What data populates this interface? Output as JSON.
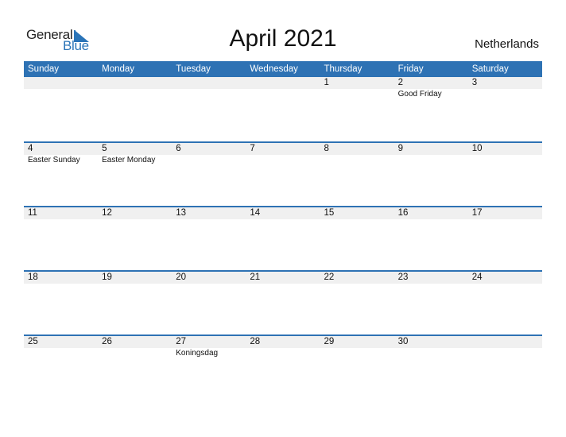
{
  "logo": {
    "general": "General",
    "blue": "Blue"
  },
  "title": "April 2021",
  "country": "Netherlands",
  "accent_color": "#2e72b4",
  "weekdays": [
    "Sunday",
    "Monday",
    "Tuesday",
    "Wednesday",
    "Thursday",
    "Friday",
    "Saturday"
  ],
  "weeks": [
    [
      {
        "day": "",
        "holiday": ""
      },
      {
        "day": "",
        "holiday": ""
      },
      {
        "day": "",
        "holiday": ""
      },
      {
        "day": "",
        "holiday": ""
      },
      {
        "day": "1",
        "holiday": ""
      },
      {
        "day": "2",
        "holiday": "Good Friday"
      },
      {
        "day": "3",
        "holiday": ""
      }
    ],
    [
      {
        "day": "4",
        "holiday": "Easter Sunday"
      },
      {
        "day": "5",
        "holiday": "Easter Monday"
      },
      {
        "day": "6",
        "holiday": ""
      },
      {
        "day": "7",
        "holiday": ""
      },
      {
        "day": "8",
        "holiday": ""
      },
      {
        "day": "9",
        "holiday": ""
      },
      {
        "day": "10",
        "holiday": ""
      }
    ],
    [
      {
        "day": "11",
        "holiday": ""
      },
      {
        "day": "12",
        "holiday": ""
      },
      {
        "day": "13",
        "holiday": ""
      },
      {
        "day": "14",
        "holiday": ""
      },
      {
        "day": "15",
        "holiday": ""
      },
      {
        "day": "16",
        "holiday": ""
      },
      {
        "day": "17",
        "holiday": ""
      }
    ],
    [
      {
        "day": "18",
        "holiday": ""
      },
      {
        "day": "19",
        "holiday": ""
      },
      {
        "day": "20",
        "holiday": ""
      },
      {
        "day": "21",
        "holiday": ""
      },
      {
        "day": "22",
        "holiday": ""
      },
      {
        "day": "23",
        "holiday": ""
      },
      {
        "day": "24",
        "holiday": ""
      }
    ],
    [
      {
        "day": "25",
        "holiday": ""
      },
      {
        "day": "26",
        "holiday": ""
      },
      {
        "day": "27",
        "holiday": "Koningsdag"
      },
      {
        "day": "28",
        "holiday": ""
      },
      {
        "day": "29",
        "holiday": ""
      },
      {
        "day": "30",
        "holiday": ""
      },
      {
        "day": "",
        "holiday": ""
      }
    ]
  ]
}
